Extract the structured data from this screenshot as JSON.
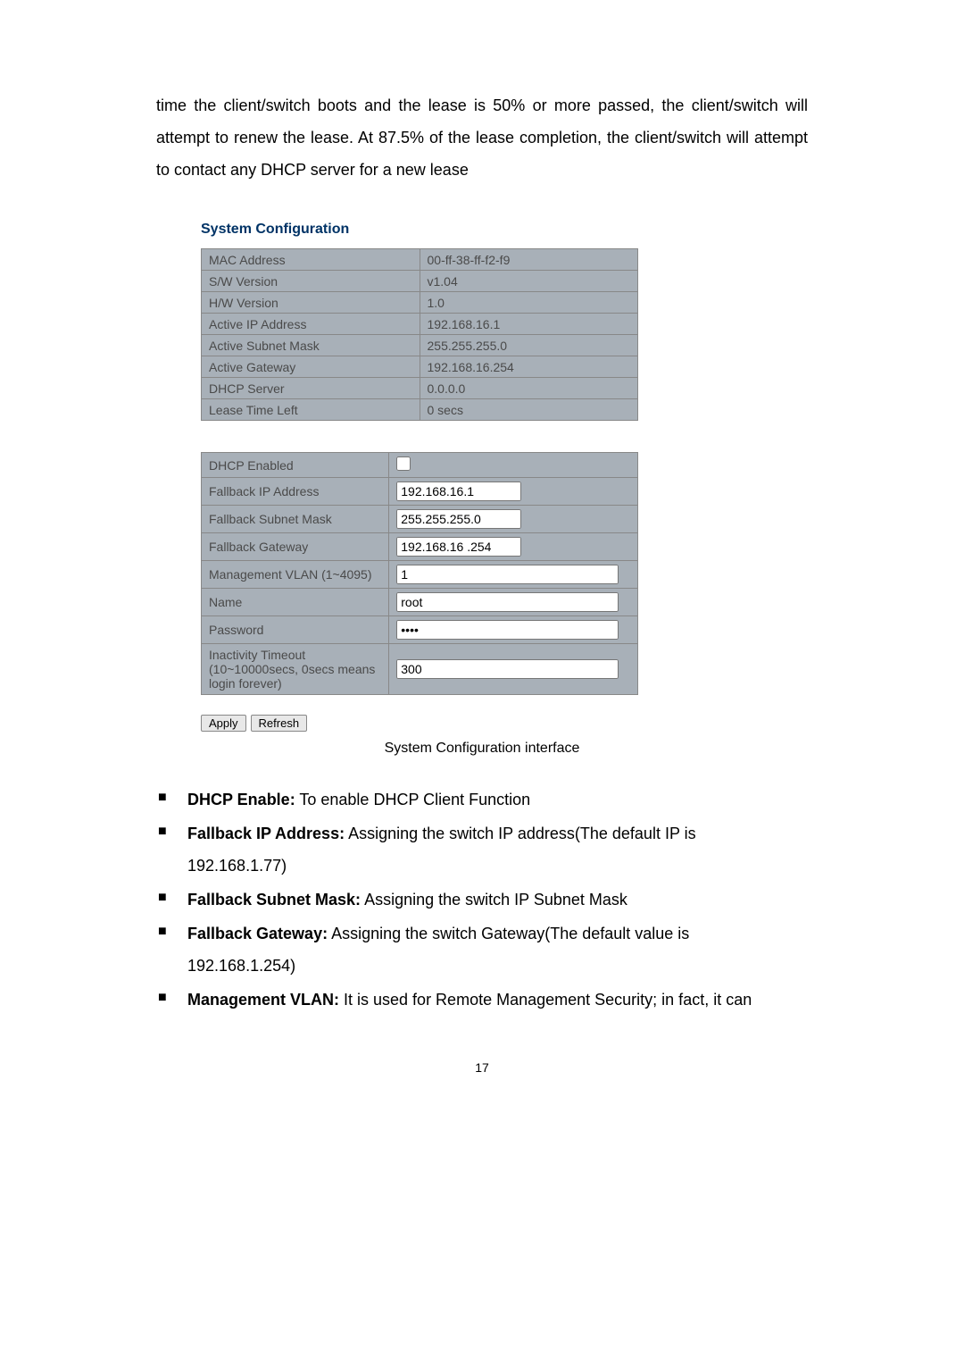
{
  "intro": "time the client/switch boots and the lease is 50% or more passed, the client/switch will attempt to renew the lease. At 87.5% of the lease completion, the client/switch will attempt to contact any DHCP server for a new lease",
  "config_title": "System Configuration",
  "status_rows": [
    {
      "label": "MAC Address",
      "value": "00-ff-38-ff-f2-f9"
    },
    {
      "label": "S/W Version",
      "value": "v1.04"
    },
    {
      "label": "H/W Version",
      "value": "1.0"
    },
    {
      "label": "Active IP Address",
      "value": "192.168.16.1"
    },
    {
      "label": "Active Subnet Mask",
      "value": "255.255.255.0"
    },
    {
      "label": "Active Gateway",
      "value": "192.168.16.254"
    },
    {
      "label": "DHCP Server",
      "value": "0.0.0.0"
    },
    {
      "label": "Lease Time Left",
      "value": "0 secs"
    }
  ],
  "form_rows": {
    "dhcp_enabled": {
      "label": "DHCP Enabled",
      "checked": false
    },
    "fallback_ip": {
      "label": "Fallback IP Address",
      "value": "192.168.16.1"
    },
    "fallback_mask": {
      "label": "Fallback Subnet Mask",
      "value": "255.255.255.0"
    },
    "fallback_gateway": {
      "label": "Fallback Gateway",
      "value": "192.168.16 .254"
    },
    "mgmt_vlan": {
      "label": "Management VLAN (1~4095)",
      "value": "1"
    },
    "name": {
      "label": "Name",
      "value": "root"
    },
    "password": {
      "label": "Password",
      "value": "••••"
    },
    "timeout": {
      "label": "Inactivity Timeout (10~10000secs, 0secs means login forever)",
      "value": "300"
    }
  },
  "buttons": {
    "apply": "Apply",
    "refresh": "Refresh"
  },
  "caption": "System Configuration interface",
  "bullets": [
    {
      "bold": "DHCP Enable:",
      "rest": " To enable DHCP Client Function",
      "sub": ""
    },
    {
      "bold": "Fallback IP Address:",
      "rest": " Assigning the switch IP address(The default IP is",
      "sub": "192.168.1.77)"
    },
    {
      "bold": "Fallback Subnet Mask:",
      "rest": " Assigning the switch IP Subnet Mask",
      "sub": ""
    },
    {
      "bold": "Fallback Gateway:",
      "rest": " Assigning the switch Gateway(The default value is",
      "sub": "192.168.1.254)"
    },
    {
      "bold": "Management VLAN:",
      "rest": " It is used for Remote Management Security; in fact, it can",
      "sub": ""
    }
  ],
  "page_number": "17"
}
